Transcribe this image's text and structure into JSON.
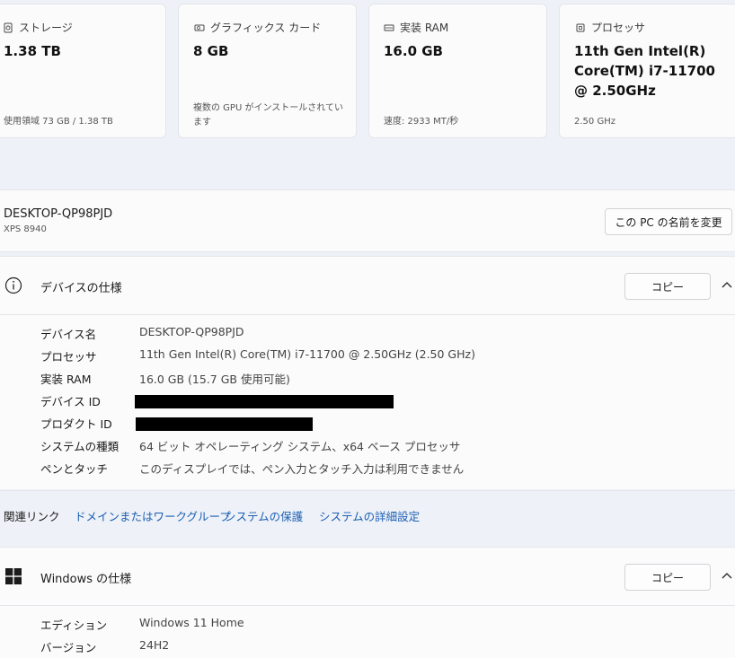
{
  "cards": [
    {
      "label": "ストレージ",
      "value": "1.38 TB",
      "sub": "使用領域 73 GB / 1.38 TB",
      "icon": "storage-icon"
    },
    {
      "label": "グラフィックス カード",
      "value": "8 GB",
      "sub": "複数の GPU がインストールされています",
      "icon": "graphics-card-icon"
    },
    {
      "label": "実装 RAM",
      "value": "16.0 GB",
      "sub": "速度: 2933 MT/秒",
      "icon": "ram-icon"
    },
    {
      "label": "プロセッサ",
      "value": "11th Gen Intel(R) Core(TM) i7-11700 @ 2.50GHz",
      "sub": "2.50 GHz",
      "icon": "processor-icon"
    }
  ],
  "device": {
    "name": "DESKTOP-QP98PJD",
    "model": "XPS 8940",
    "rename_label": "この PC の名前を変更"
  },
  "device_spec": {
    "title": "デバイスの仕様",
    "copy_label": "コピー",
    "rows": [
      {
        "key": "デバイス名",
        "value": "DESKTOP-QP98PJD"
      },
      {
        "key": "プロセッサ",
        "value": "11th Gen Intel(R) Core(TM) i7-11700 @ 2.50GHz (2.50 GHz)"
      },
      {
        "key": "実装 RAM",
        "value": "16.0 GB (15.7 GB 使用可能)"
      },
      {
        "key": "デバイス ID",
        "value": ""
      },
      {
        "key": "プロダクト ID",
        "value": ""
      },
      {
        "key": "システムの種類",
        "value": "64 ビット オペレーティング システム、x64 ベース プロセッサ"
      },
      {
        "key": "ペンとタッチ",
        "value": "このディスプレイでは、ペン入力とタッチ入力は利用できません"
      }
    ]
  },
  "related_links": {
    "label": "関連リンク",
    "links": [
      "ドメインまたはワークグループ",
      "システムの保護",
      "システムの詳細設定"
    ]
  },
  "windows_spec": {
    "title": "Windows の仕様",
    "copy_label": "コピー",
    "rows": [
      {
        "key": "エディション",
        "value": "Windows 11 Home"
      },
      {
        "key": "バージョン",
        "value": "24H2"
      }
    ]
  },
  "colors": {
    "link": "#1a5fb4",
    "background": "#eef1f7",
    "panel": "#fbfbfb"
  }
}
